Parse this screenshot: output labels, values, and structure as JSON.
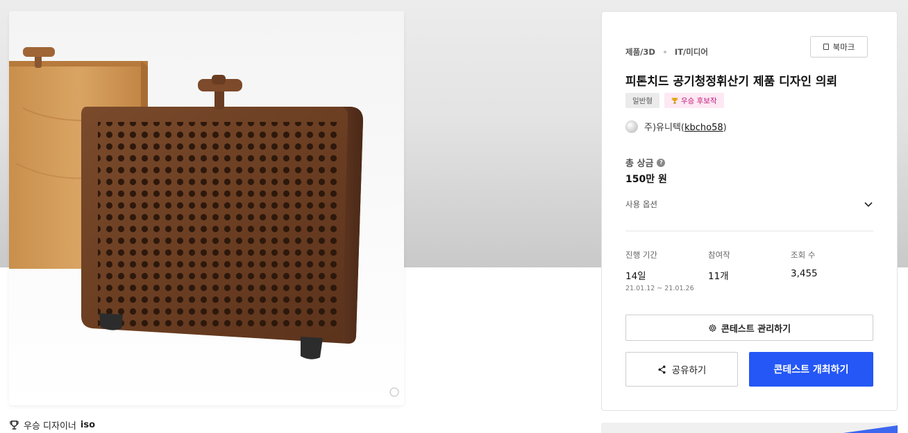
{
  "contest": {
    "category_primary": "제품/3D",
    "category_secondary": "IT/미디어",
    "bookmark_label": "북마크",
    "title": "피톤치드 공기청정휘산기 제품 디자인 의뢰",
    "badge_type": "일반형",
    "badge_winner": "우승 후보작",
    "host_name": "주)유니텍",
    "host_id": "kbcho58",
    "prize_label": "총 상금",
    "prize_value": "150만 원",
    "usage_option_label": "사용 옵션",
    "stats": {
      "period_label": "진행 기간",
      "period_value": "14일",
      "period_dates": "21.01.12 ~ 21.01.26",
      "entries_label": "참여작",
      "entries_value": "11개",
      "views_label": "조회 수",
      "views_value": "3,455"
    },
    "manage_button": "콘테스트 관리하기",
    "share_button": "공유하기",
    "host_contest_button": "콘테스트 개최하기"
  },
  "image": {
    "winner_caption_prefix": "우승 디자이너",
    "winner_name": "iso"
  },
  "colors": {
    "primary_blue": "#2457f5",
    "winner_badge_bg": "#fde8f3",
    "winner_badge_text": "#c2187a"
  }
}
